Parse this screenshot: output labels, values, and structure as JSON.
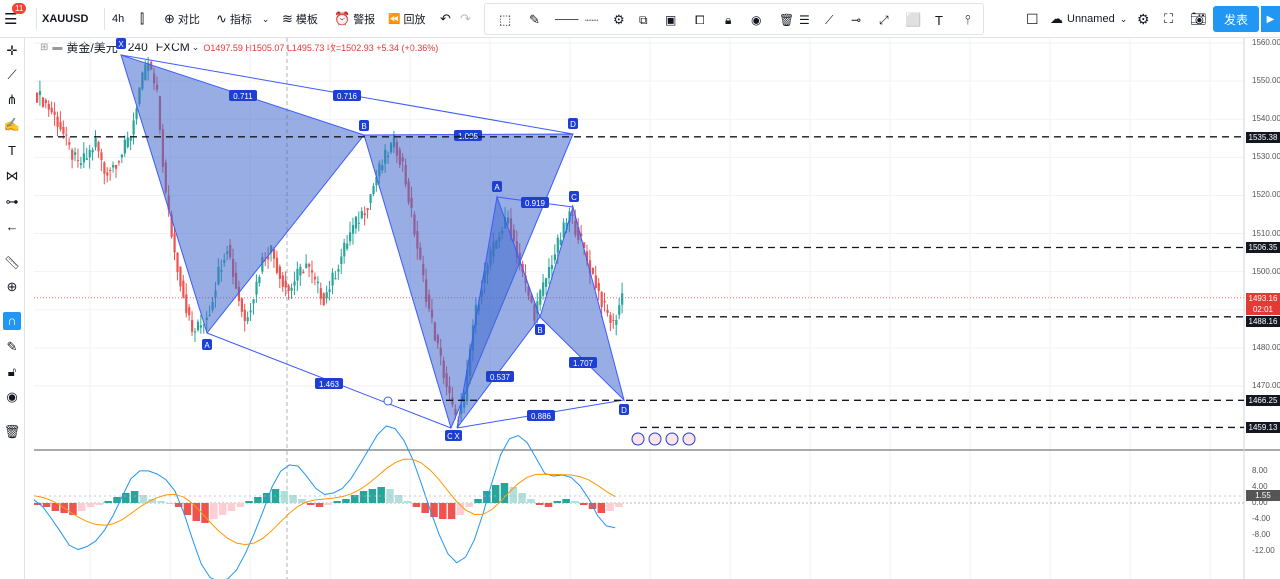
{
  "toolbar": {
    "symbol": "XAUUSD",
    "interval": "4h",
    "compare_label": "对比",
    "indicators_label": "指标",
    "templates_label": "模板",
    "alert_label": "警报",
    "replay_label": "回放",
    "layout_name": "Unnamed",
    "publish_label": "发表",
    "notification_count": "11"
  },
  "legend": {
    "title": "黄金/美元",
    "interval": "240",
    "source": "FXCM",
    "ohlc": "O1497.59  H1505.07  L1495.73  收=1502.93  +5.34 (+0.36%)"
  },
  "price_axis": {
    "ticks": [
      "1560.00",
      "1550.00",
      "1540.00",
      "1530.00",
      "1520.00",
      "1510.00",
      "1500.00",
      "1490.00",
      "1480.00",
      "1470.00"
    ],
    "labels": [
      {
        "text": "1535.38",
        "color": "#131722"
      },
      {
        "text": "1506.35",
        "color": "#131722"
      },
      {
        "text": "1493.16",
        "color": "#e53935"
      },
      {
        "text": "02:01",
        "color": "#e53935"
      },
      {
        "text": "1488.16",
        "color": "#131722"
      },
      {
        "text": "1466.25",
        "color": "#131722"
      },
      {
        "text": "1459.13",
        "color": "#131722"
      }
    ]
  },
  "macd_axis": {
    "ticks": [
      "8.00",
      "4.00",
      "0.00",
      "-4.00",
      "-8.00",
      "-12.00"
    ],
    "current": "1.55"
  },
  "chart_data": [
    {
      "type": "candlestick",
      "title": "黄金/美元",
      "ylim": [
        1458,
        1562
      ],
      "horizontal_levels": [
        1535.38,
        1506.35,
        1488.16,
        1466.25,
        1459.13
      ],
      "last_price": 1493.16,
      "harmonic_patterns": [
        {
          "points": [
            {
              "label": "X",
              "price": 1557
            },
            {
              "label": "A",
              "price": 1484
            },
            {
              "label": "B",
              "price": 1535
            },
            {
              "label": "C",
              "price": 1459
            },
            {
              "label": "D",
              "price": 1535
            }
          ],
          "ratios": [
            "0.711",
            "0.716",
            "1.463",
            "1.005"
          ]
        },
        {
          "points": [
            {
              "label": "X",
              "price": 1459
            },
            {
              "label": "A",
              "price": 1519
            },
            {
              "label": "B",
              "price": 1487
            },
            {
              "label": "C",
              "price": 1517
            },
            {
              "label": "D",
              "price": 1466
            }
          ],
          "ratios": [
            "0.537",
            "0.919",
            "1.707",
            "0.886"
          ]
        }
      ],
      "close_path": [
        1545,
        1542,
        1538,
        1532,
        1528,
        1530,
        1534,
        1526,
        1528,
        1531,
        1536,
        1548,
        1555,
        1546,
        1520,
        1505,
        1494,
        1484,
        1486,
        1490,
        1500,
        1507,
        1496,
        1487,
        1494,
        1503,
        1506,
        1499,
        1495,
        1499,
        1502,
        1497,
        1493,
        1498,
        1504,
        1510,
        1514,
        1518,
        1525,
        1530,
        1534,
        1528,
        1515,
        1502,
        1490,
        1480,
        1470,
        1461,
        1466,
        1486,
        1497,
        1504,
        1510,
        1514,
        1505,
        1496,
        1489,
        1496,
        1503,
        1509,
        1515,
        1510,
        1503,
        1497,
        1490,
        1486,
        1494
      ]
    },
    {
      "type": "bar",
      "title": "MACD",
      "ylim": [
        -12,
        8
      ],
      "histogram": [
        -0.5,
        -1,
        -2,
        -2.5,
        -3,
        -2,
        -1,
        -0.5,
        0.5,
        1.5,
        2.5,
        3,
        2,
        1,
        0.5,
        0,
        -1,
        -3,
        -4.5,
        -5,
        -4,
        -3,
        -2,
        -1,
        0.5,
        1.5,
        2.5,
        3.5,
        3,
        2,
        1,
        -0.5,
        -1,
        -0.5,
        0.5,
        1,
        2,
        3,
        3.5,
        4,
        3.5,
        2,
        0.5,
        -1,
        -2.5,
        -3.5,
        -4,
        -4,
        -3,
        -1,
        1,
        3,
        4.5,
        5,
        4,
        2.5,
        1,
        -0.5,
        -1,
        0.5,
        1,
        0.5,
        -0.5,
        -1.5,
        -2.5,
        -2,
        -1
      ]
    }
  ]
}
